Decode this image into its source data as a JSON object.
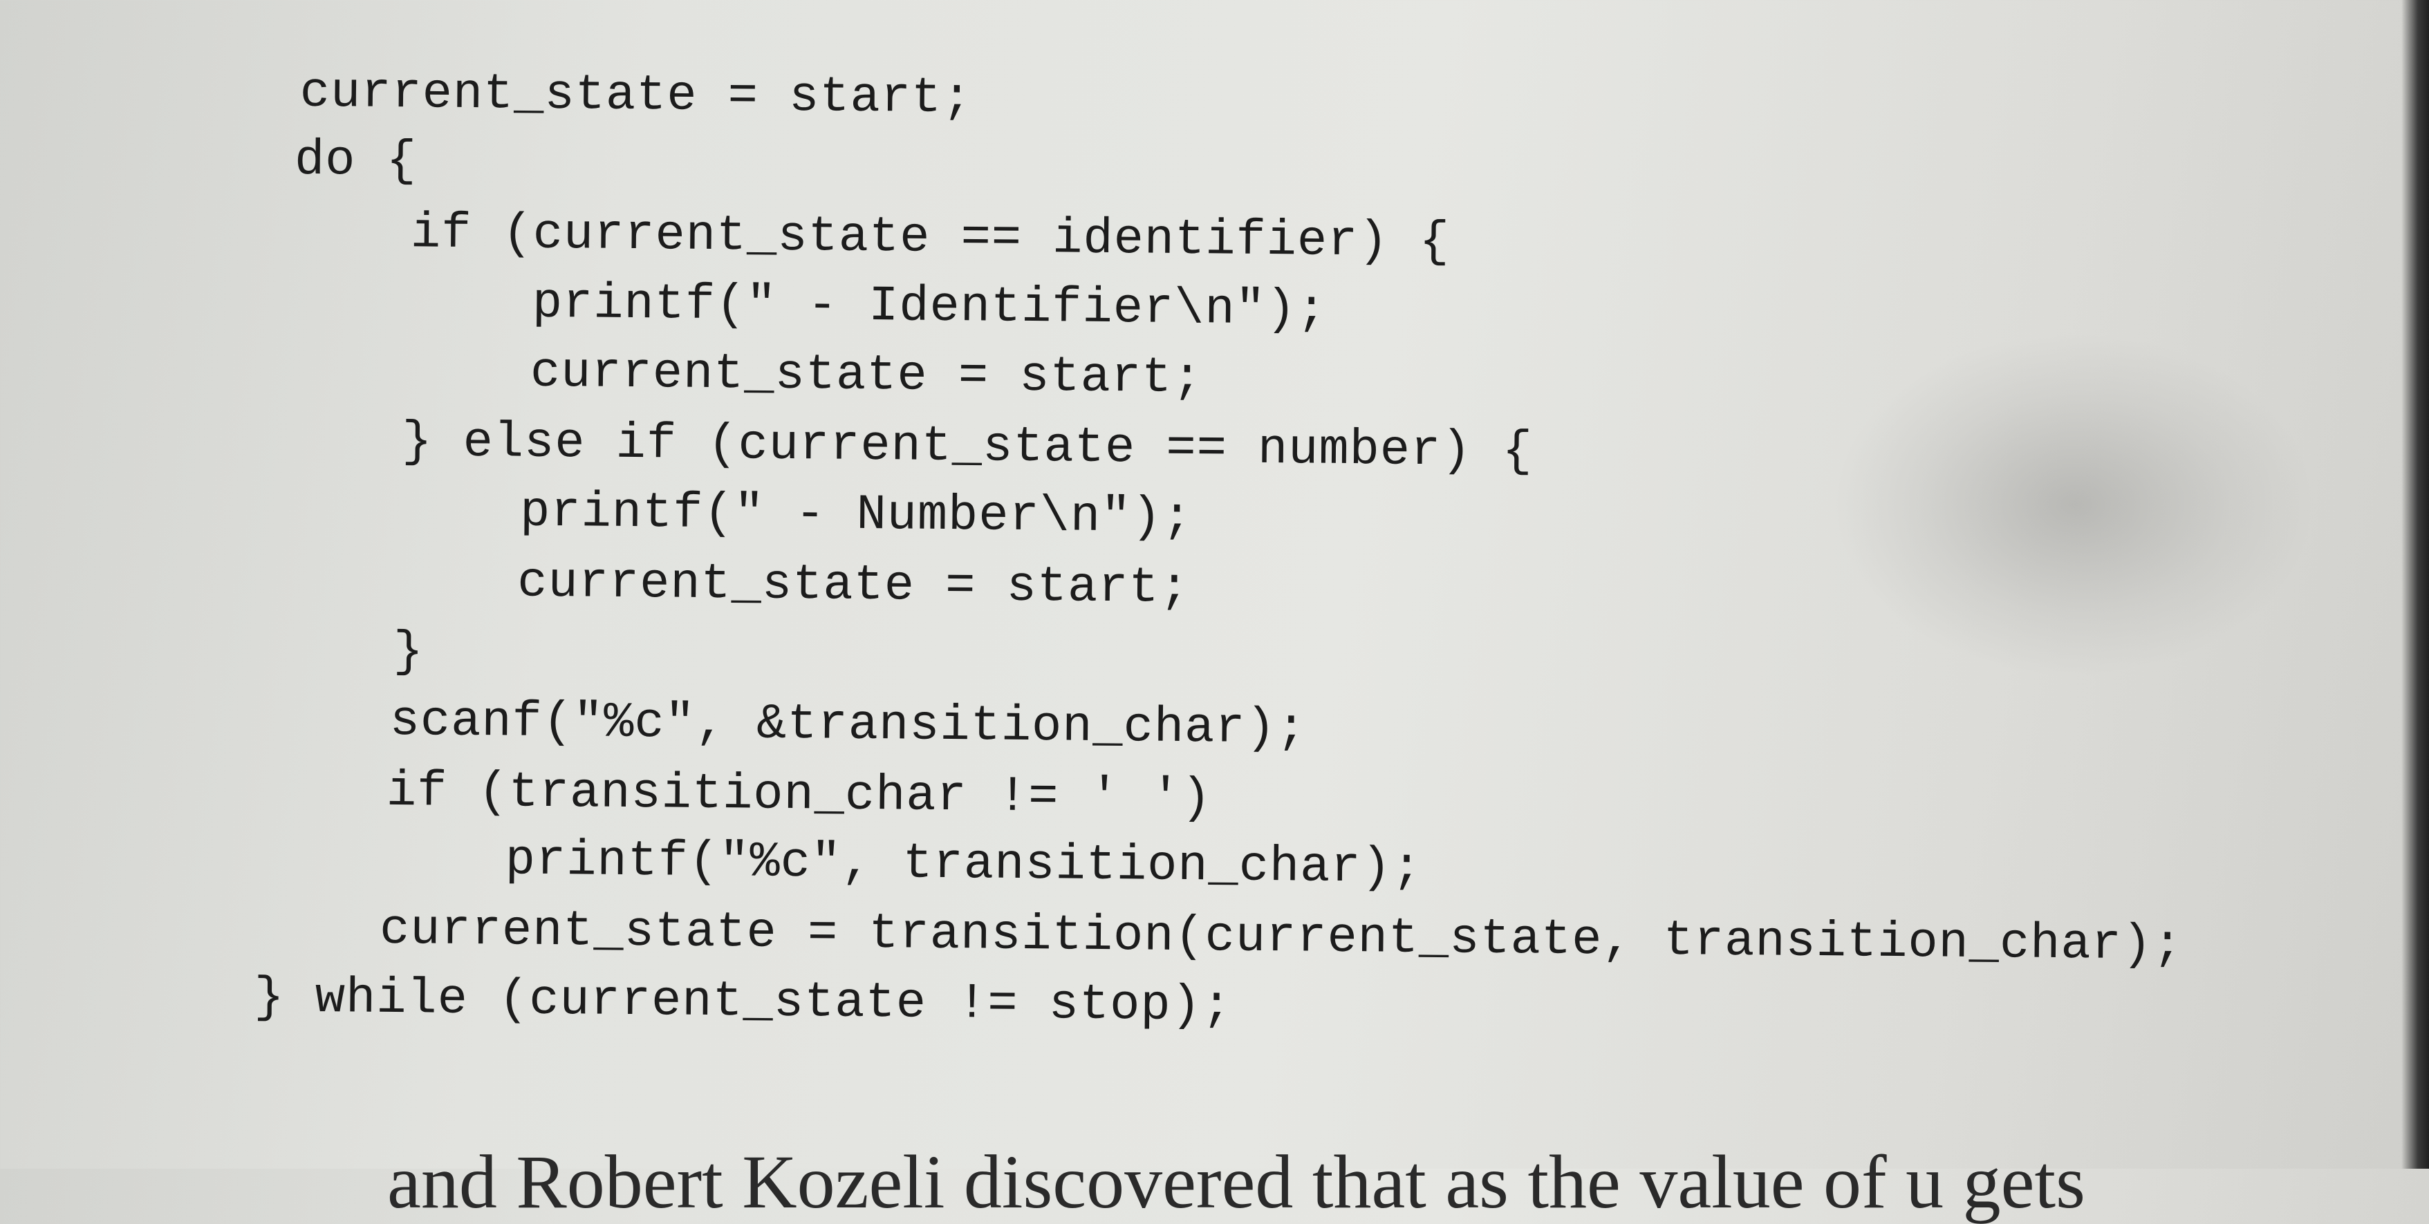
{
  "code": {
    "lines": [
      "current_state = start;",
      "do {",
      "    if (current_state == identifier) {",
      "        printf(\" - Identifier\\n\");",
      "        current_state = start;",
      "    } else if (current_state == number) {",
      "        printf(\" - Number\\n\");",
      "        current_state = start;",
      "    }",
      "    scanf(\"%c\", &transition_char);",
      "    if (transition_char != ' ')",
      "        printf(\"%c\", transition_char);",
      "    current_state = transition(current_state, transition_char);",
      "} while (current_state != stop);"
    ]
  },
  "prose": {
    "partial_line": "and Robert Kozeli discovered that as the value of u gets"
  }
}
